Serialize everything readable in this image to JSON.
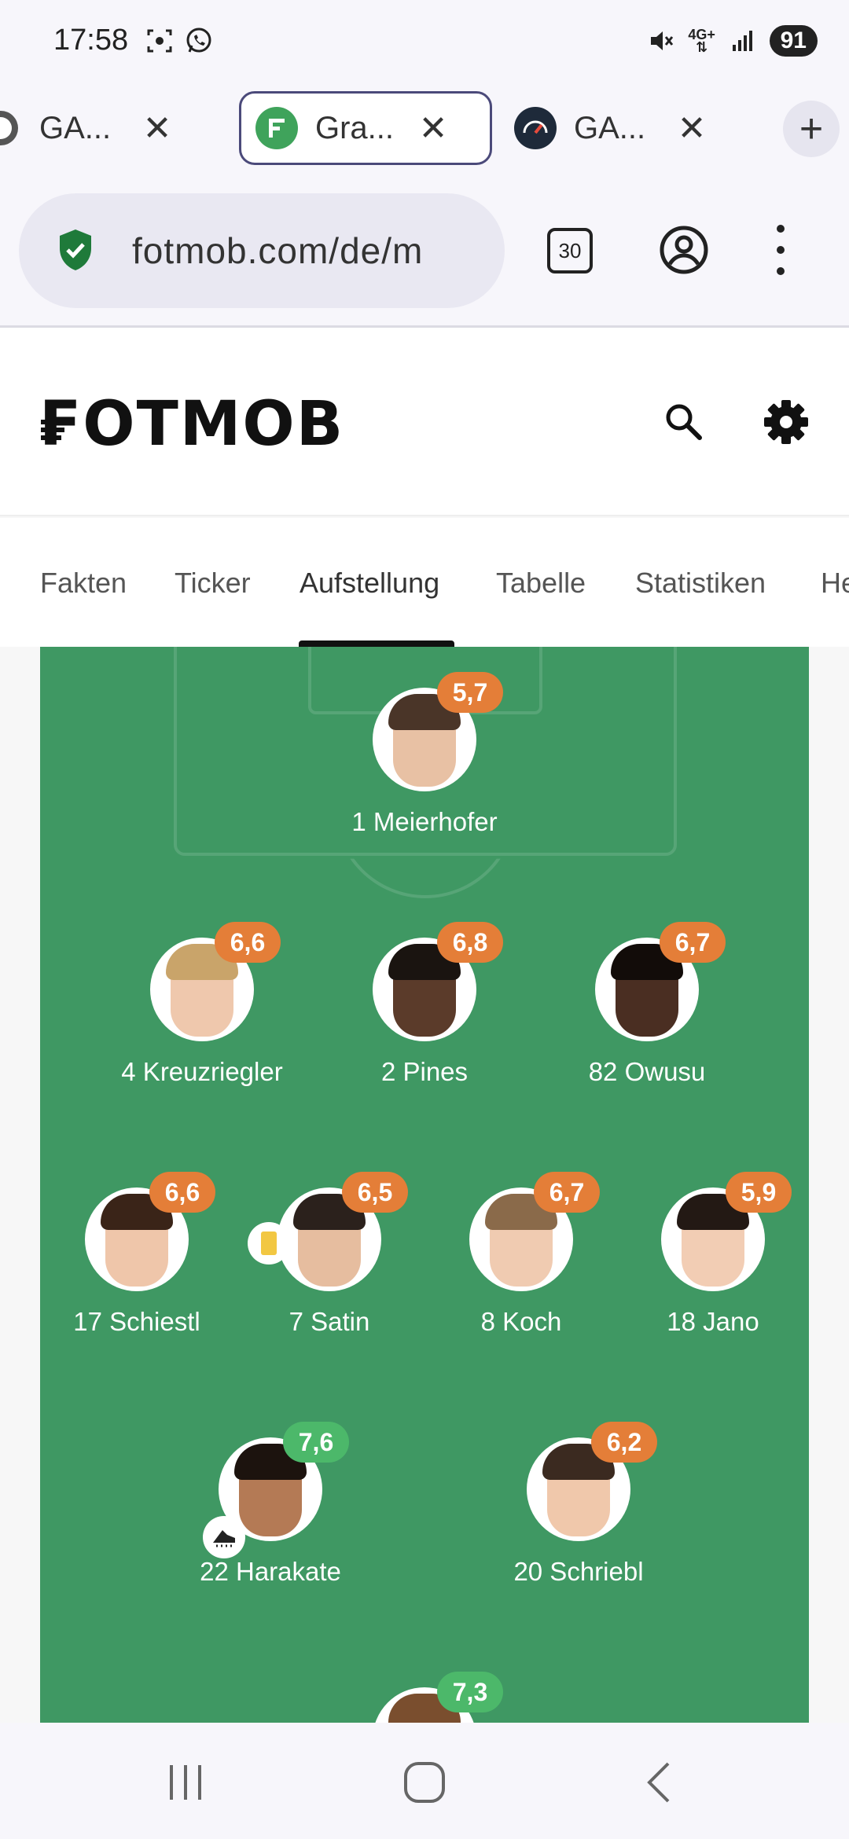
{
  "status_bar": {
    "time": "17:58",
    "battery": "91",
    "network": "4G+",
    "icons": [
      "screenshot-icon",
      "whatsapp-icon",
      "mute-icon",
      "network-icon",
      "signal-icon"
    ]
  },
  "tabs": [
    {
      "title": "GA...",
      "favicon": "partial-circle-icon"
    },
    {
      "title": "Gra...",
      "favicon": "fotmob-icon",
      "active": true
    },
    {
      "title": "GA...",
      "favicon": "speedometer-icon"
    }
  ],
  "url_bar": {
    "url": "fotmob.com/de/m",
    "tab_count": "30"
  },
  "site": {
    "logo": "FOTMOB"
  },
  "match_tabs": [
    "Fakten",
    "Ticker",
    "Aufstellung",
    "Tabelle",
    "Statistiken",
    "He"
  ],
  "active_match_tab": "Aufstellung",
  "colors": {
    "pitch": "#3f9863",
    "rating_orange": "#e47e38",
    "rating_green": "#4cb86a"
  },
  "lineup": [
    {
      "number": "1",
      "name": "Meierhofer",
      "label": "1 Meierhofer",
      "rating": "5,7",
      "rating_color": "orange"
    },
    {
      "number": "4",
      "name": "Kreuzriegler",
      "label": "4 Kreuzriegler",
      "rating": "6,6",
      "rating_color": "orange"
    },
    {
      "number": "2",
      "name": "Pines",
      "label": "2 Pines",
      "rating": "6,8",
      "rating_color": "orange"
    },
    {
      "number": "82",
      "name": "Owusu",
      "label": "82 Owusu",
      "rating": "6,7",
      "rating_color": "orange"
    },
    {
      "number": "17",
      "name": "Schiestl",
      "label": "17 Schiestl",
      "rating": "6,6",
      "rating_color": "orange"
    },
    {
      "number": "7",
      "name": "Satin",
      "label": "7 Satin",
      "rating": "6,5",
      "rating_color": "orange",
      "event": "yellow-card"
    },
    {
      "number": "8",
      "name": "Koch",
      "label": "8 Koch",
      "rating": "6,7",
      "rating_color": "orange"
    },
    {
      "number": "18",
      "name": "Jano",
      "label": "18 Jano",
      "rating": "5,9",
      "rating_color": "orange"
    },
    {
      "number": "22",
      "name": "Harakate",
      "label": "22 Harakate",
      "rating": "7,6",
      "rating_color": "green",
      "event": "goal-assist-boot"
    },
    {
      "number": "20",
      "name": "Schriebl",
      "label": "20 Schriebl",
      "rating": "6,2",
      "rating_color": "orange"
    },
    {
      "number": "",
      "name": "",
      "label": "",
      "rating": "7,3",
      "rating_color": "green"
    }
  ]
}
